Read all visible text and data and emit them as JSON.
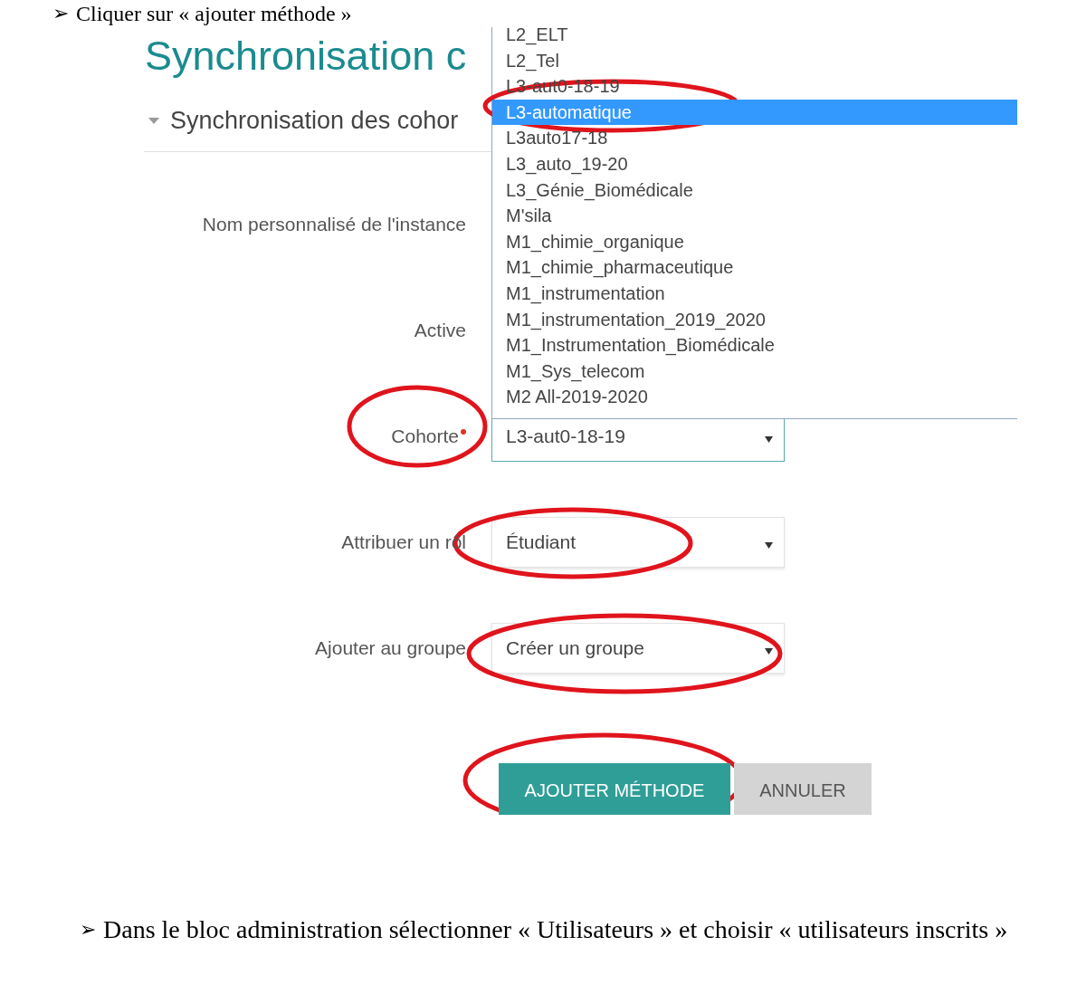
{
  "instructions": [
    {
      "bullet": "➢",
      "text": "Cliquer sur « ajouter méthode »"
    },
    {
      "bullet": "➢",
      "text": "Dans le bloc administration sélectionner « Utilisateurs » et choisir  « utilisateurs inscrits »"
    }
  ],
  "screenshot": {
    "title": "Synchronisation c",
    "section": {
      "label": "Synchronisation des cohor",
      "expanded": true
    },
    "fields": [
      {
        "kind": "label",
        "label": "Nom personnalisé de l'instance",
        "required": false
      },
      {
        "kind": "label",
        "label": "Active",
        "required": false
      },
      {
        "kind": "select",
        "label": "Cohorte",
        "required": true,
        "value": "L3-aut0-18-19",
        "focused": true
      },
      {
        "kind": "select",
        "label": "Attribuer un rôl",
        "required": false,
        "value": "Étudiant",
        "focused": false
      },
      {
        "kind": "select",
        "label": "Ajouter au groupe",
        "required": false,
        "value": "Créer un groupe",
        "focused": false
      }
    ],
    "buttons": [
      {
        "label": "AJOUTER MÉTHODE",
        "kind": "primary"
      },
      {
        "label": "ANNULER",
        "kind": "secondary"
      }
    ],
    "dropdown": {
      "options": [
        {
          "label": "L2_ELT",
          "selected": false
        },
        {
          "label": "L2_Tel",
          "selected": false
        },
        {
          "label": "L3-aut0-18-19",
          "selected": false
        },
        {
          "label": "L3-automatique",
          "selected": true
        },
        {
          "label": "L3auto17-18",
          "selected": false
        },
        {
          "label": "L3_auto_19-20",
          "selected": false
        },
        {
          "label": "L3_Génie_Biomédicale",
          "selected": false
        },
        {
          "label": "M'sila",
          "selected": false
        },
        {
          "label": "M1_chimie_organique",
          "selected": false
        },
        {
          "label": "M1_chimie_pharmaceutique",
          "selected": false
        },
        {
          "label": "M1_instrumentation",
          "selected": false
        },
        {
          "label": "M1_instrumentation_2019_2020",
          "selected": false
        },
        {
          "label": "M1_Instrumentation_Biomédicale",
          "selected": false
        },
        {
          "label": "M1_Sys_telecom",
          "selected": false
        },
        {
          "label": "M2 All-2019-2020",
          "selected": false
        }
      ]
    }
  }
}
